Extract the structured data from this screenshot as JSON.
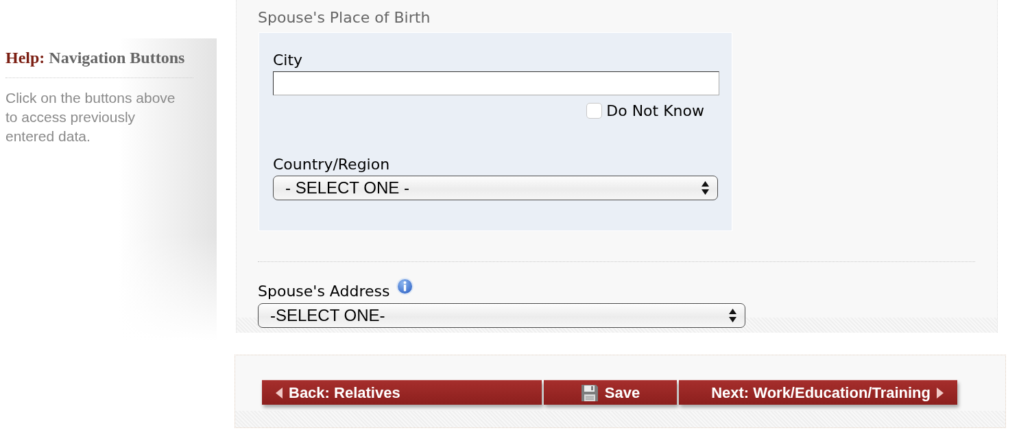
{
  "help": {
    "label": "Help:",
    "title": "Navigation Buttons",
    "text": "Click on the buttons above to access previously entered data."
  },
  "place_of_birth": {
    "heading": "Spouse's Place of Birth",
    "city": {
      "label": "City"
    },
    "do_not_know": {
      "label": "Do Not Know",
      "checked": false
    },
    "country": {
      "label": "Country/Region",
      "value": "- SELECT ONE -"
    }
  },
  "address": {
    "label": "Spouse's Address",
    "value": "-SELECT ONE-"
  },
  "nav_buttons": [
    {
      "kind": "back",
      "label": "Back: Relatives"
    },
    {
      "kind": "save",
      "label": "Save"
    },
    {
      "kind": "next",
      "label": "Next: Work/Education/Training"
    }
  ]
}
